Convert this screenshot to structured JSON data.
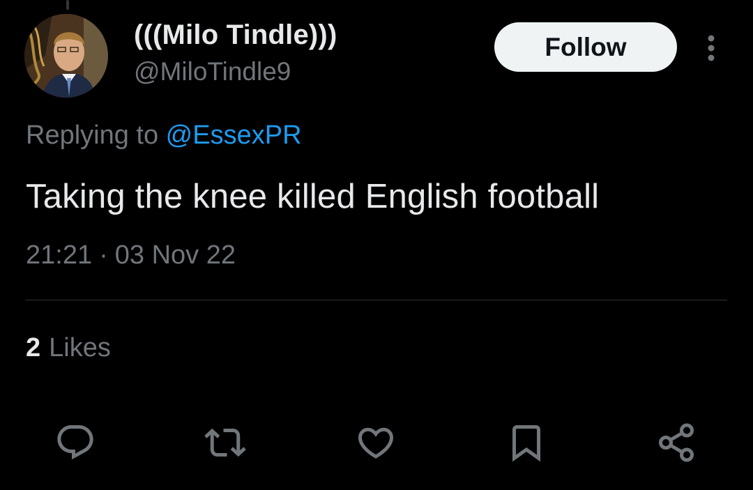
{
  "tweet": {
    "display_name": "(((Milo Tindle)))",
    "handle": "@MiloTindle9",
    "follow_label": "Follow",
    "replying_prefix": "Replying to",
    "replying_to": "@EssexPR",
    "text": "Taking the knee killed English football",
    "time": "21:21",
    "separator": "·",
    "date": "03 Nov 22",
    "likes_count": "2",
    "likes_label": "Likes"
  },
  "actions": {
    "reply": "reply-icon",
    "retweet": "retweet-icon",
    "like": "heart-icon",
    "bookmark": "bookmark-icon",
    "share": "share-icon"
  },
  "colors": {
    "background": "#000000",
    "primary_text": "#e7e9ea",
    "secondary_text": "#71767b",
    "link": "#1d9bf0",
    "follow_bg": "#eff3f4"
  }
}
